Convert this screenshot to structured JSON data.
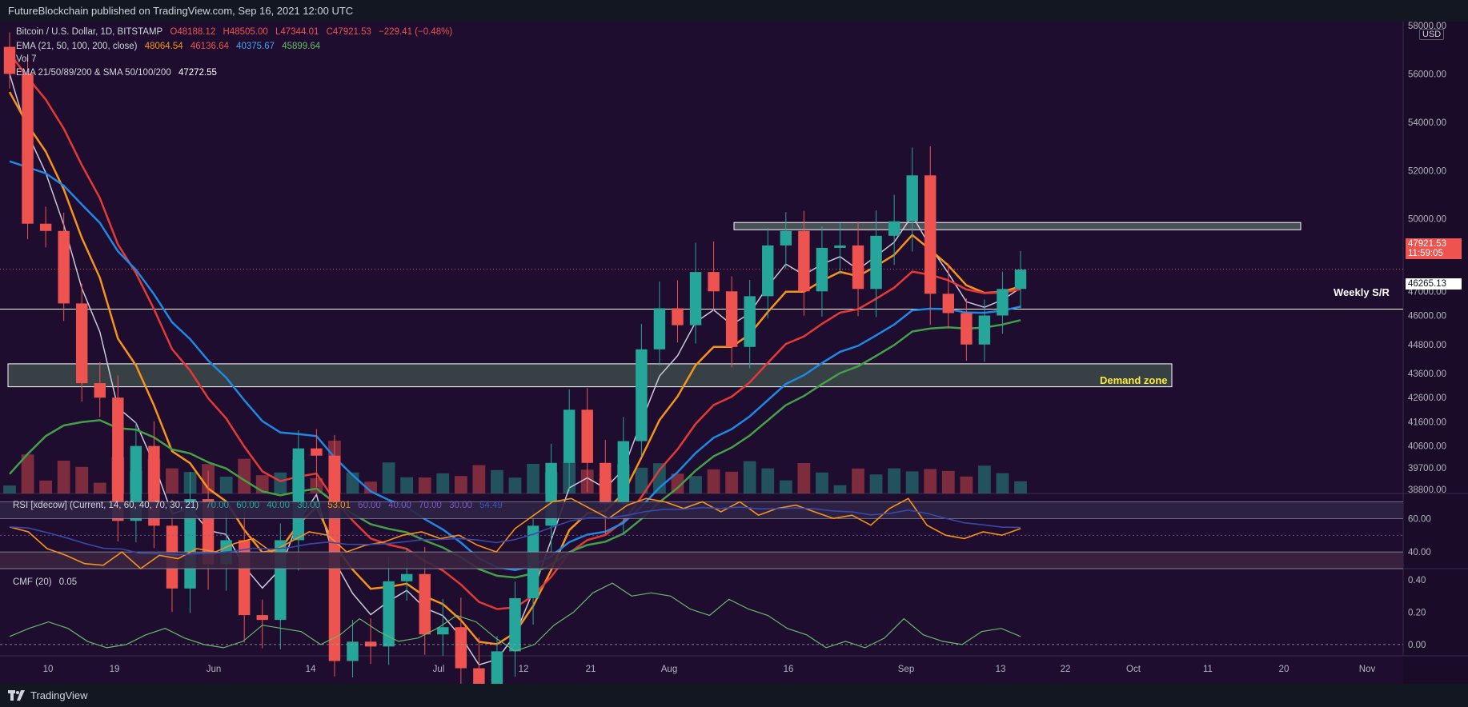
{
  "header": {
    "publisher": "FutureBlockchain published on TradingView.com, Sep 16, 2021 12:00 UTC"
  },
  "footer": {
    "brand": "TradingView",
    "logo_icon": "tradingview-logo-icon"
  },
  "legend": {
    "symbol": "Bitcoin / U.S. Dollar, 1D, BITSTAMP",
    "ohlc": {
      "o": "O48188.12",
      "h": "H48505.00",
      "l": "L47344.01",
      "c": "C47921.53",
      "chg": "−229.41 (−0.48%)"
    },
    "ema_line": {
      "label": "EMA (21, 50, 100, 200, close)",
      "v1": "48064.54",
      "v2": "46136.64",
      "v3": "40375.67",
      "v4": "45899.64"
    },
    "vol_label": "Vol 7",
    "ema_sma_line": {
      "label": "EMA 21/50/89/200 & SMA 50/100/200",
      "value": "47272.55"
    }
  },
  "price_axis": {
    "currency": "USD",
    "ticks": [
      "58000.00",
      "56000.00",
      "54000.00",
      "52000.00",
      "50000.00",
      "48800.00",
      "47000.00",
      "46000.00",
      "44800.00",
      "43600.00",
      "42600.00",
      "41600.00",
      "40600.00",
      "39700.00",
      "38800.00"
    ],
    "last_price": "47921.53",
    "countdown": "11:59:05",
    "sr_price": "46265.13"
  },
  "annotations": {
    "weekly_sr": "Weekly S/R",
    "demand_zone": "Demand zone"
  },
  "time_axis": [
    "10",
    "19",
    "Jun",
    "14",
    "Jul",
    "12",
    "21",
    "Aug",
    "16",
    "Sep",
    "13",
    "22",
    "Oct",
    "11",
    "20",
    "Nov"
  ],
  "rsi_panel": {
    "label": "RSI [xdecow] (Current, 14, 60, 40, 70, 30, 21)",
    "values": [
      "70.00",
      "60.00",
      "40.00",
      "30.00",
      "53.01",
      "60.00",
      "40.00",
      "70.00",
      "30.00",
      "54.49"
    ],
    "ticks": [
      "60.00",
      "40.00"
    ]
  },
  "cmf_panel": {
    "label": "CMF (20)",
    "value": "0.05",
    "ticks": [
      "0.40",
      "0.20",
      "0.00"
    ]
  },
  "colors": {
    "background": "#1e0d2e",
    "up": "#26a69a",
    "down": "#ef5350",
    "ema21": "#c9c9d9",
    "ema50": "#f7931a",
    "ema100": "#e53935",
    "ema200": "#1e88e5",
    "sma": "#43a047"
  },
  "chart_data": [
    {
      "type": "candlestick",
      "symbol": "BTCUSD",
      "timeframe": "1D",
      "series_shape_note": "approximate daily closes",
      "x": [
        "2021-05-10",
        "2021-05-12",
        "2021-05-14",
        "2021-05-16",
        "2021-05-17",
        "2021-05-18",
        "2021-05-19",
        "2021-05-20",
        "2021-05-21",
        "2021-05-23",
        "2021-05-25",
        "2021-05-28",
        "2021-06-01",
        "2021-06-07",
        "2021-06-08",
        "2021-06-10",
        "2021-06-14",
        "2021-06-15",
        "2021-06-21",
        "2021-06-22",
        "2021-06-26",
        "2021-06-30",
        "2021-07-04",
        "2021-07-08",
        "2021-07-12",
        "2021-07-16",
        "2021-07-20",
        "2021-07-21",
        "2021-07-24",
        "2021-07-26",
        "2021-07-28",
        "2021-07-30",
        "2021-08-01",
        "2021-08-03",
        "2021-08-05",
        "2021-08-07",
        "2021-08-09",
        "2021-08-11",
        "2021-08-13",
        "2021-08-15",
        "2021-08-17",
        "2021-08-19",
        "2021-08-21",
        "2021-08-23",
        "2021-08-25",
        "2021-08-27",
        "2021-08-29",
        "2021-08-31",
        "2021-09-02",
        "2021-09-04",
        "2021-09-06",
        "2021-09-07",
        "2021-09-08",
        "2021-09-10",
        "2021-09-12",
        "2021-09-14",
        "2021-09-16"
      ],
      "close": [
        56000,
        49800,
        49500,
        46500,
        43200,
        42600,
        37500,
        40600,
        37300,
        34700,
        38400,
        35700,
        36700,
        33600,
        33400,
        36700,
        40500,
        40200,
        31700,
        32500,
        32300,
        35000,
        35300,
        32800,
        33100,
        31400,
        29800,
        32100,
        34300,
        37300,
        39900,
        42100,
        39900,
        38200,
        40800,
        44600,
        46300,
        45600,
        47800,
        47000,
        44700,
        46800,
        48900,
        49500,
        47000,
        48800,
        48900,
        47100,
        49300,
        49900,
        51800,
        46900,
        46100,
        44800,
        46000,
        47100,
        47900
      ],
      "ylim": [
        38800,
        58000
      ]
    },
    {
      "type": "line",
      "name": "RSI",
      "title": "RSI [xdecow] (Current, 14, 60, 40, 70, 30, 21)",
      "values": [
        55,
        52,
        42,
        38,
        33,
        32,
        40,
        30,
        38,
        36,
        42,
        40,
        45,
        48,
        40,
        46,
        52,
        50,
        40,
        44,
        46,
        50,
        52,
        48,
        50,
        44,
        40,
        54,
        62,
        70,
        72,
        66,
        60,
        68,
        72,
        70,
        66,
        70,
        64,
        70,
        62,
        66,
        68,
        64,
        60,
        62,
        56,
        66,
        72,
        56,
        50,
        48,
        52,
        50,
        54
      ],
      "ylim": [
        30,
        75
      ]
    },
    {
      "type": "line",
      "name": "CMF",
      "title": "CMF (20)",
      "values": [
        0.05,
        0.1,
        0.14,
        0.1,
        0.02,
        -0.02,
        0.0,
        0.06,
        0.1,
        0.04,
        0.0,
        -0.02,
        0.02,
        0.12,
        0.1,
        0.08,
        0.0,
        0.06,
        0.16,
        0.08,
        0.02,
        0.04,
        0.1,
        0.18,
        0.14,
        0.04,
        -0.04,
        0.0,
        0.12,
        0.2,
        0.32,
        0.38,
        0.3,
        0.32,
        0.3,
        0.22,
        0.18,
        0.28,
        0.22,
        0.18,
        0.1,
        0.06,
        -0.02,
        0.02,
        -0.02,
        0.04,
        0.16,
        0.06,
        0.02,
        0.0,
        0.08,
        0.1,
        0.05
      ],
      "ylim": [
        -0.05,
        0.45
      ]
    }
  ]
}
